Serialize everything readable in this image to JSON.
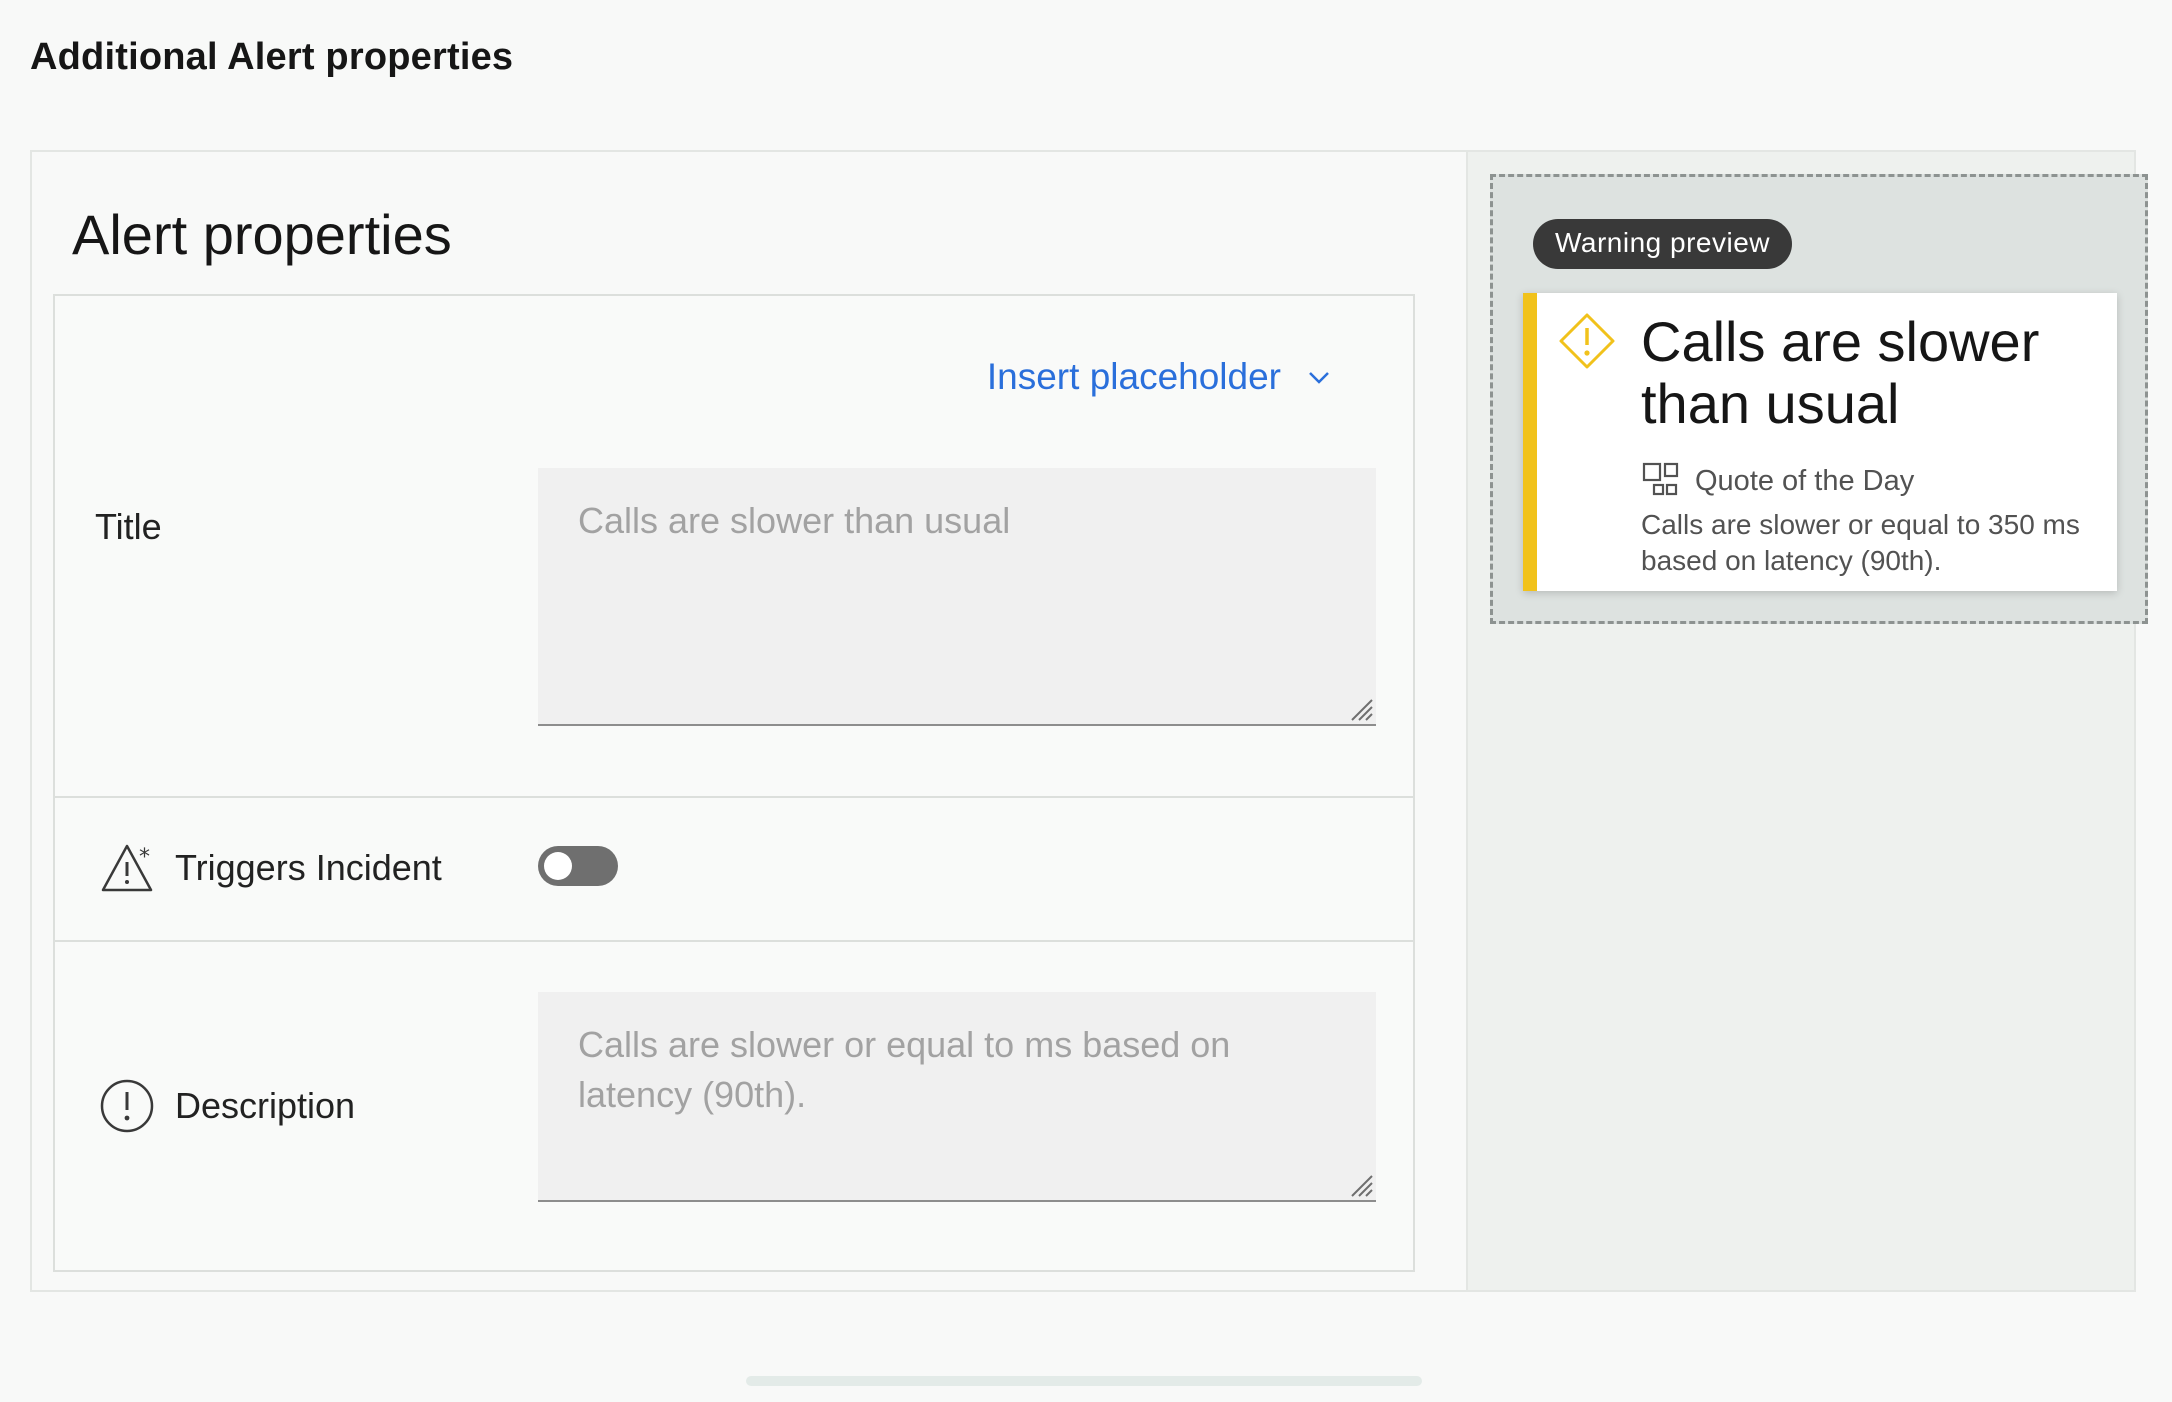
{
  "page": {
    "heading": "Additional Alert properties"
  },
  "alert_properties": {
    "section_title": "Alert properties",
    "insert_placeholder_label": "Insert placeholder",
    "title_field": {
      "label": "Title",
      "placeholder": "Calls are slower than usual"
    },
    "triggers_incident": {
      "label": "Triggers Incident",
      "enabled": false
    },
    "description_field": {
      "label": "Description",
      "placeholder": "Calls are slower or equal to  ms based on latency (90th)."
    }
  },
  "preview": {
    "badge": "Warning preview",
    "card": {
      "title": "Calls are slower than usual",
      "source": "Quote of the Day",
      "description": "Calls are slower or equal to 350 ms based on latency (90th)."
    },
    "accent_color": "#f1c21b"
  },
  "icons": {
    "insert_placeholder": "chevron-down-icon",
    "triggers_incident": "incident-warning-icon",
    "description": "info-circle-icon",
    "card": "warning-diamond-icon",
    "source": "application-icon"
  },
  "colors": {
    "link": "#2a6fdb",
    "toggle_off": "#6f6f6f",
    "warning": "#f1c21b"
  }
}
